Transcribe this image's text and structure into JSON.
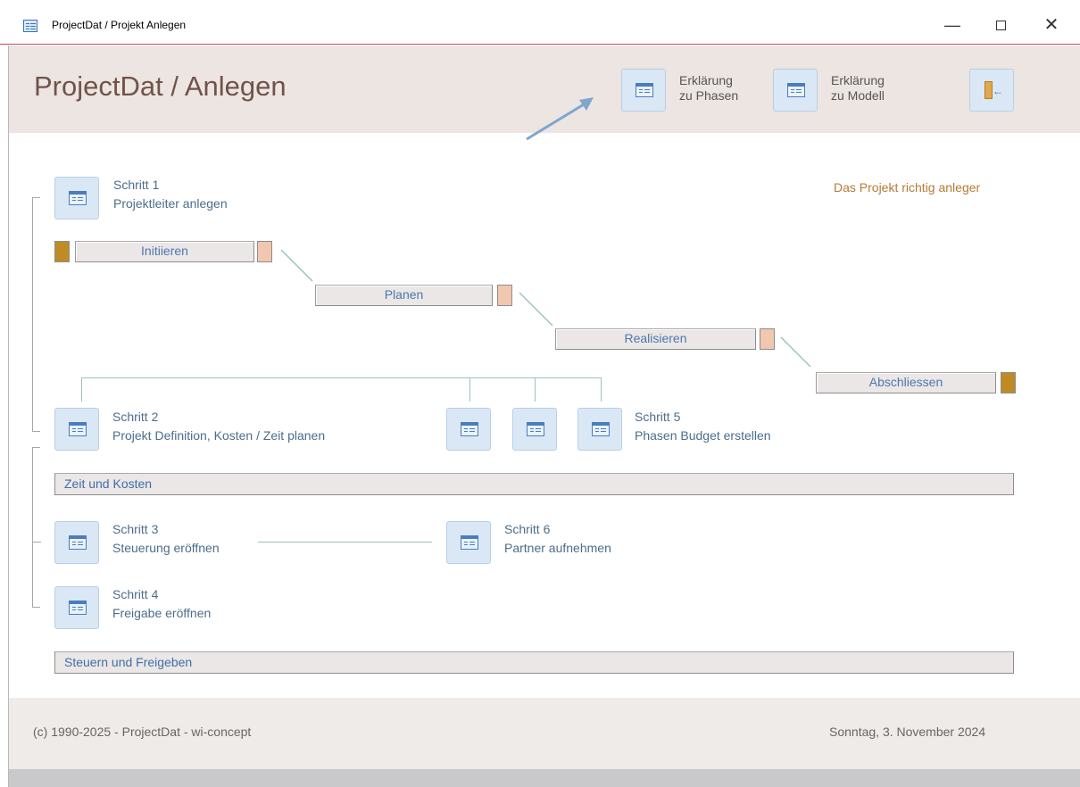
{
  "window": {
    "title": "ProjectDat / Projekt Anlegen",
    "minimize": "—",
    "close": "✕"
  },
  "header": {
    "title": "ProjectDat / Anlegen",
    "buttons": [
      {
        "line1": "Erklärung",
        "line2": "zu Phasen"
      },
      {
        "line1": "Erklärung",
        "line2": "zu Modell"
      }
    ],
    "exit_icon": "exit-door-icon"
  },
  "note": "Das Projekt richtig anleger",
  "steps": {
    "step1": {
      "title": "Schritt 1",
      "subtitle": "Projektleiter anlegen"
    },
    "step2": {
      "title": "Schritt 2",
      "subtitle": "Projekt Definition, Kosten / Zeit planen"
    },
    "step3": {
      "title": "Schritt 3",
      "subtitle": "Steuerung eröffnen"
    },
    "step4": {
      "title": "Schritt 4",
      "subtitle": "Freigabe eröffnen"
    },
    "step5": {
      "title": "Schritt 5",
      "subtitle": "Phasen Budget erstellen"
    },
    "step6": {
      "title": "Schritt 6",
      "subtitle": "Partner aufnehmen"
    }
  },
  "phases": [
    "Initiieren",
    "Planen",
    "Realisieren",
    "Abschliessen"
  ],
  "sections": {
    "time_cost": "Zeit und Kosten",
    "control_release": "Steuern und Freigeben"
  },
  "footer": {
    "copyright": "(c) 1990-2025 - ProjectDat - wi-concept",
    "date": "Sonntag, 3. November 2024"
  },
  "colors": {
    "header_bg": "#ede5e2",
    "title_text": "#71534a",
    "link_blue": "#4d77ae",
    "note_orange": "#b77a34",
    "marker_light": "#f1c7af",
    "marker_dark": "#bf8b24"
  }
}
